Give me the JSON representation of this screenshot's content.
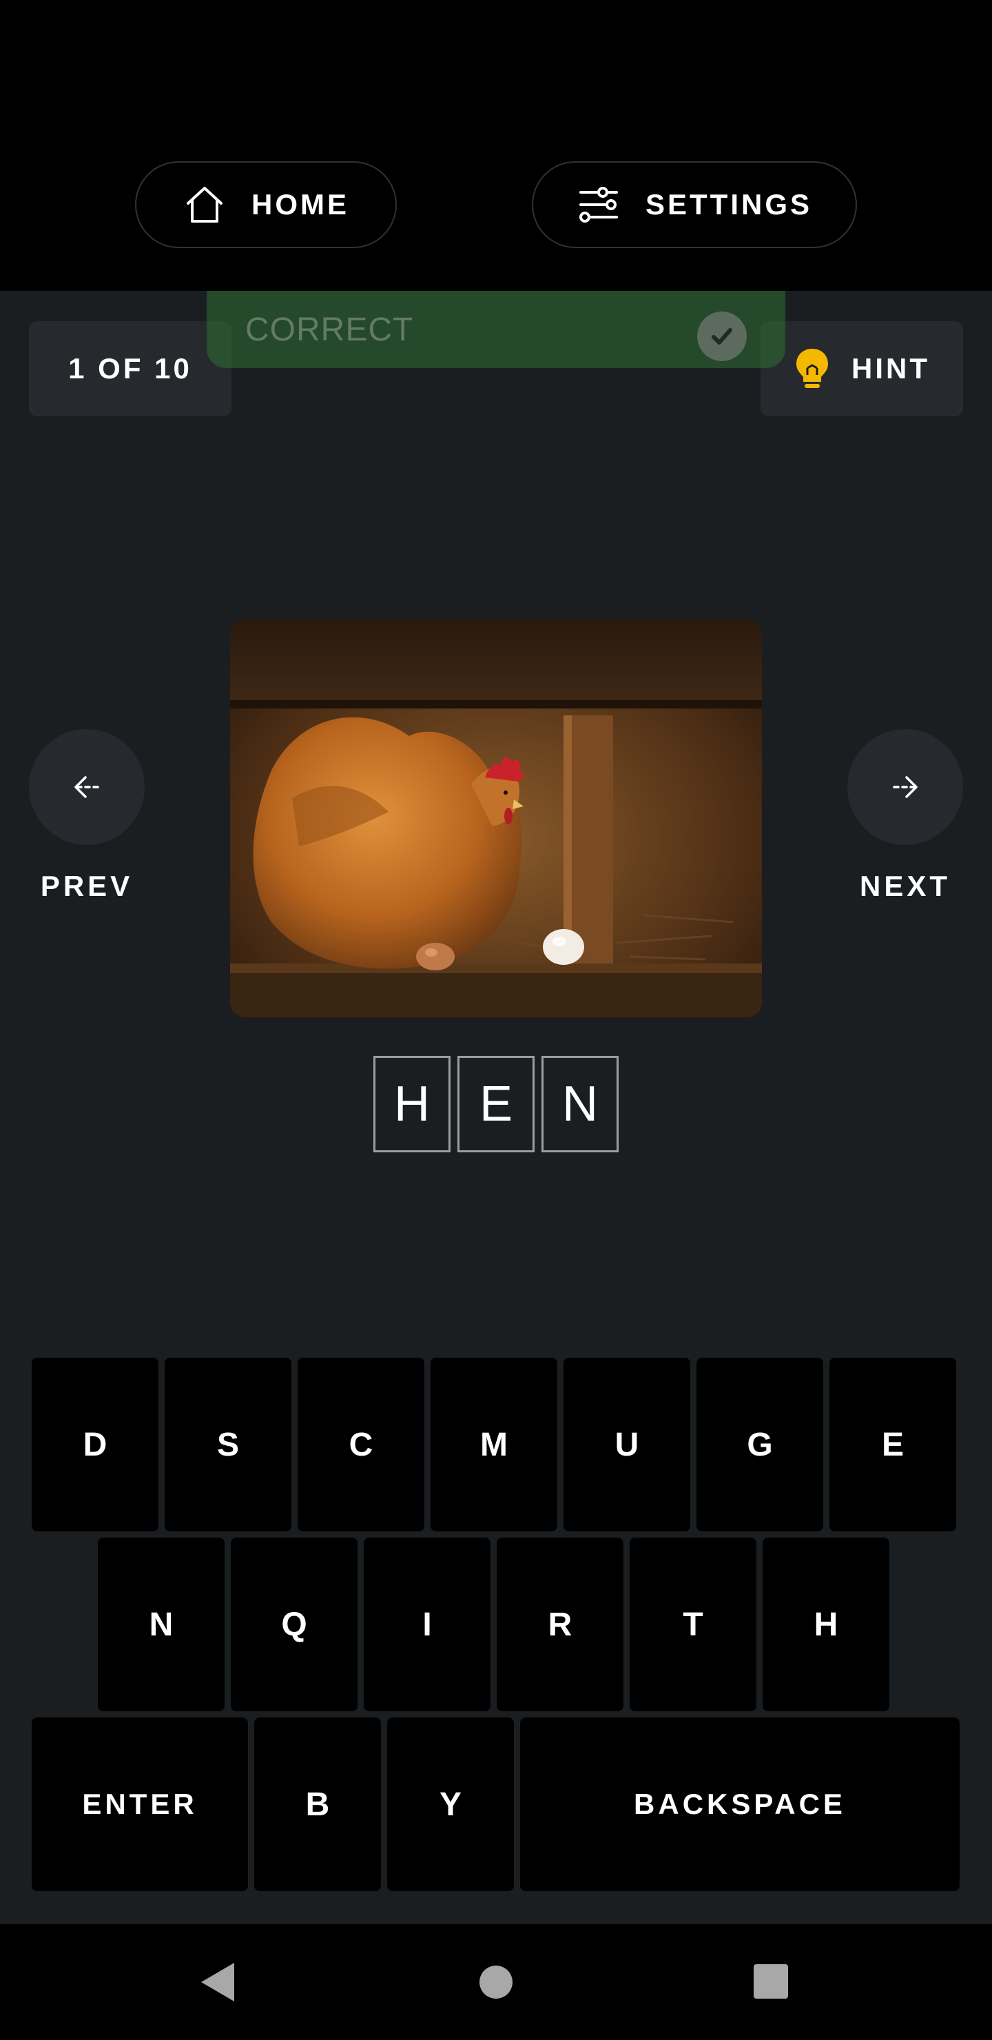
{
  "header": {
    "home_label": "HOME",
    "home_icon": "home-icon",
    "settings_label": "SETTINGS",
    "settings_icon": "sliders-icon"
  },
  "status": {
    "progress_text": "1 OF 10",
    "hint_label": "HINT",
    "hint_icon": "lightbulb-icon",
    "hint_color": "#f5b800"
  },
  "toast": {
    "text": "CORRECT",
    "icon": "check-circle-icon",
    "color": "#2e6e34"
  },
  "navigation": {
    "prev_label": "PREV",
    "prev_icon": "arrow-left-icon",
    "next_label": "NEXT",
    "next_icon": "arrow-right-icon"
  },
  "puzzle": {
    "image_subject": "hen",
    "answer_letters": [
      "H",
      "E",
      "N"
    ]
  },
  "keyboard": {
    "row1": [
      "D",
      "S",
      "C",
      "M",
      "U",
      "G",
      "E"
    ],
    "row2": [
      "N",
      "Q",
      "I",
      "R",
      "T",
      "H"
    ],
    "row3": [
      "ENTER",
      "B",
      "Y",
      "BACKSPACE"
    ]
  },
  "system_nav": {
    "back_icon": "triangle-back-icon",
    "home_icon": "circle-home-icon",
    "recents_icon": "square-recents-icon"
  }
}
